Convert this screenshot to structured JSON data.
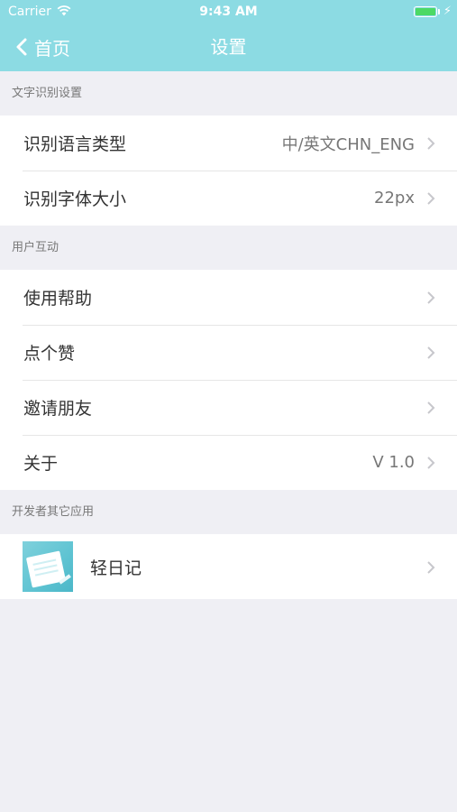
{
  "status_bar": {
    "carrier": "Carrier",
    "time": "9:43 AM"
  },
  "nav": {
    "back_label": "首页",
    "title": "设置"
  },
  "sections": [
    {
      "header": "文字识别设置",
      "rows": [
        {
          "label": "识别语言类型",
          "value": "中/英文CHN_ENG"
        },
        {
          "label": "识别字体大小",
          "value": "22px"
        }
      ]
    },
    {
      "header": "用户互动",
      "rows": [
        {
          "label": "使用帮助",
          "value": ""
        },
        {
          "label": "点个赞",
          "value": ""
        },
        {
          "label": "邀请朋友",
          "value": ""
        },
        {
          "label": "关于",
          "value": "V 1.0"
        }
      ]
    },
    {
      "header": "开发者其它应用",
      "rows": [
        {
          "label": "轻日记",
          "value": ""
        }
      ]
    }
  ],
  "colors": {
    "nav_background": "#8cdbe3",
    "page_background": "#efeff4",
    "battery": "#4cd964"
  },
  "icons": {
    "wifi": "wifi-icon",
    "battery": "battery-icon",
    "back": "chevron-left-icon",
    "disclosure": "chevron-right-icon",
    "app_thumbnail": "diary-app-icon"
  }
}
